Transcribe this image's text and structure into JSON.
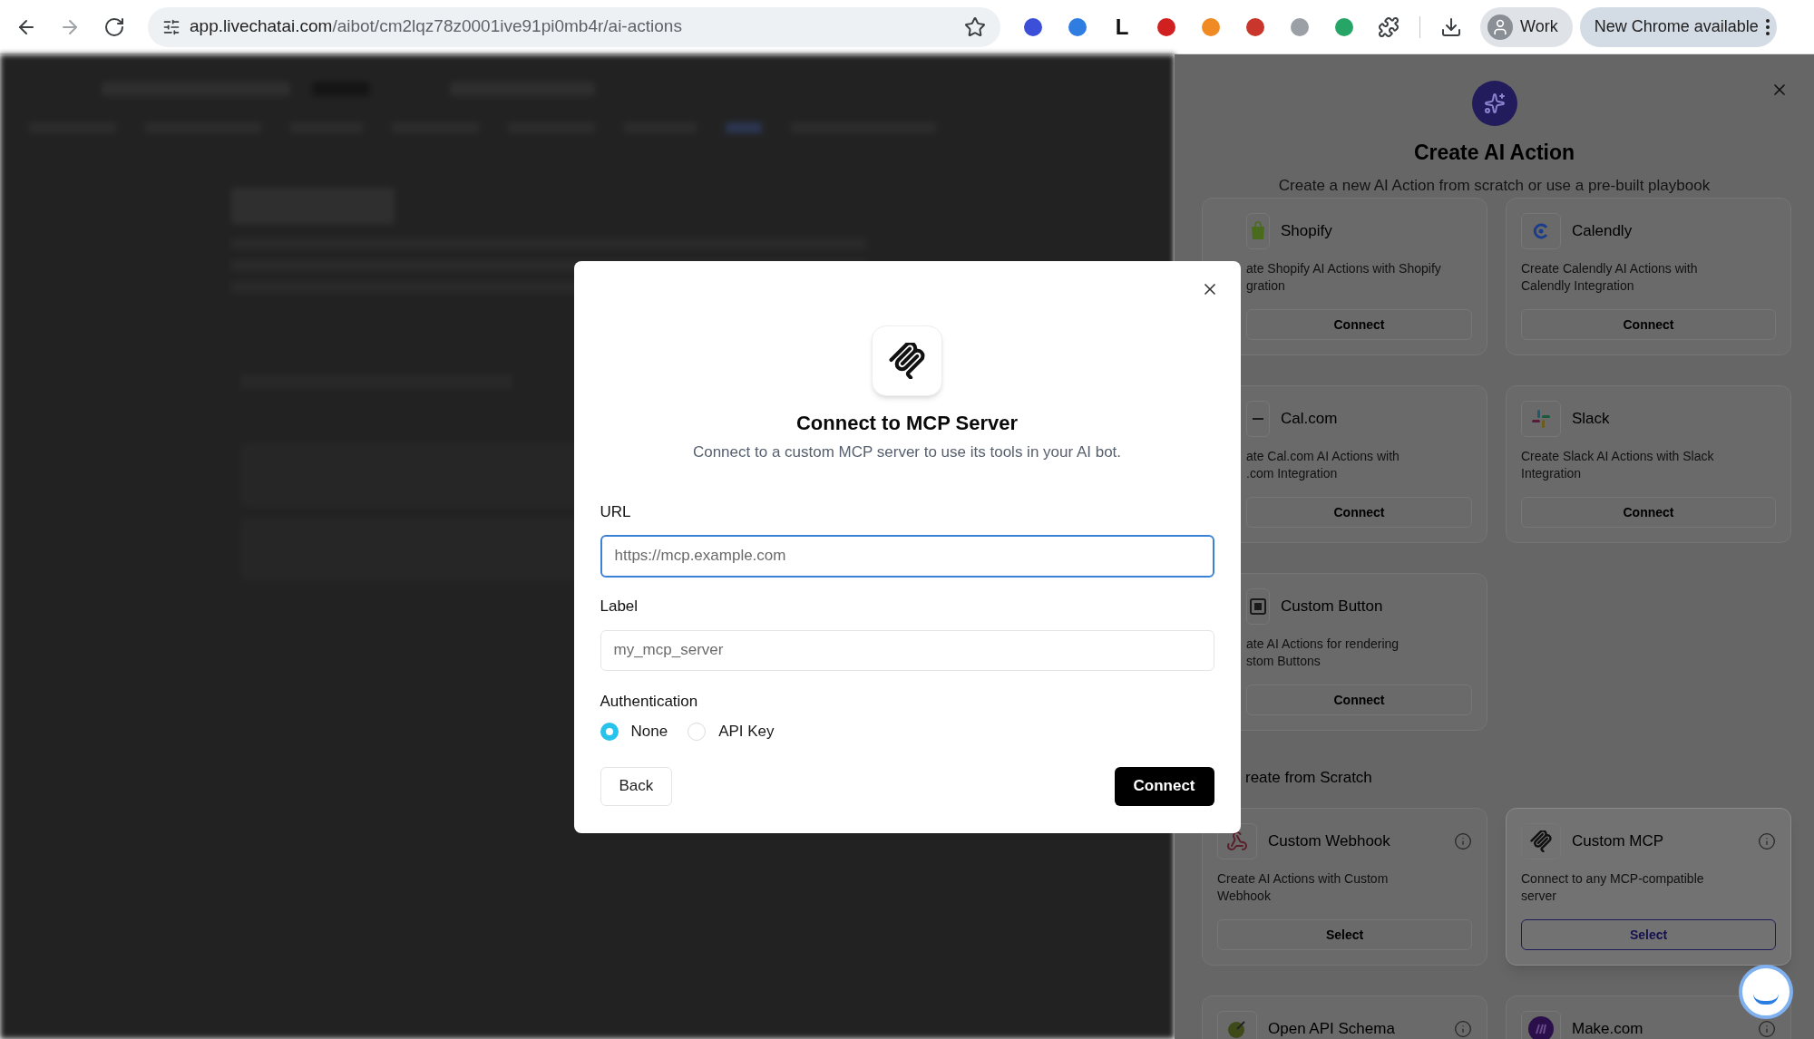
{
  "browser": {
    "url_domain": "app.livechatai.com",
    "url_path": "/aibot/cm2lqz78z0001ive91pi0mb4r/ai-actions",
    "extension_letter": "L",
    "profile": "Work",
    "update_button": "New Chrome available"
  },
  "panel": {
    "title": "Create AI Action",
    "subtitle": "Create a new AI Action from scratch or use a pre-built playbook",
    "integrations": [
      {
        "kind": "shopify",
        "name": "Shopify",
        "description_lines": [
          "ate Shopify AI Actions with Shopify",
          "gration"
        ],
        "button": "Connect"
      },
      {
        "kind": "calendly",
        "name": "Calendly",
        "description_lines": [
          "Create Calendly AI Actions with",
          "Calendly Integration"
        ],
        "button": "Connect"
      },
      {
        "kind": "calcom",
        "name": "Cal.com",
        "description_lines": [
          "ate Cal.com AI Actions with",
          ".com Integration"
        ],
        "button": "Connect"
      },
      {
        "kind": "slack",
        "name": "Slack",
        "description_lines": [
          "Create Slack AI Actions with Slack",
          "Integration"
        ],
        "button": "Connect"
      },
      {
        "kind": "custombutton",
        "name": "Custom Button",
        "description_lines": [
          "ate AI Actions for rendering",
          "stom Buttons"
        ],
        "button": "Connect"
      }
    ],
    "section_title": "reate from Scratch",
    "scratch": [
      {
        "kind": "webhook",
        "name": "Custom Webhook",
        "description_lines": [
          "Create AI Actions with Custom",
          "Webhook"
        ],
        "button": "Select",
        "selected": false
      },
      {
        "kind": "mcp",
        "name": "Custom MCP",
        "description_lines": [
          "Connect to any MCP-compatible",
          "server"
        ],
        "button": "Select",
        "selected": true
      },
      {
        "kind": "openapi",
        "name": "Open API Schema"
      },
      {
        "kind": "make",
        "name": "Make.com"
      }
    ]
  },
  "dialog": {
    "title": "Connect to MCP Server",
    "subtitle": "Connect to a custom MCP server to use its tools in your AI bot.",
    "fields": [
      {
        "label": "URL",
        "placeholder": "https://mcp.example.com",
        "focused": true
      },
      {
        "label": "Label",
        "placeholder": "my_mcp_server",
        "focused": false
      }
    ],
    "auth_label": "Authentication",
    "auth_options": [
      {
        "label": "None",
        "selected": true
      },
      {
        "label": "API Key",
        "selected": false
      }
    ],
    "back_button": "Back",
    "connect_button": "Connect"
  }
}
